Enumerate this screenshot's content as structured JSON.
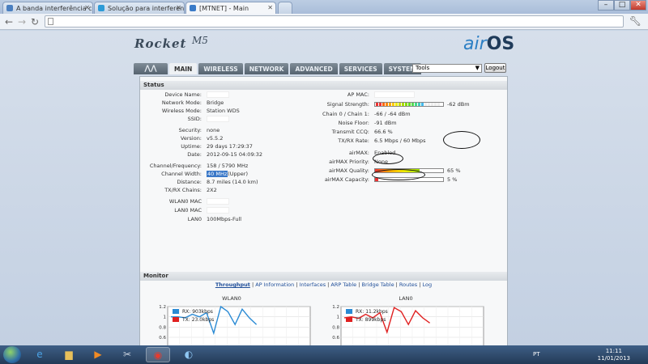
{
  "browser": {
    "tabs": [
      {
        "title": "A banda interferência com",
        "icon_color": "#4a7fc0"
      },
      {
        "title": "Solução para interferencia",
        "icon_color": "#2d9bd7"
      },
      {
        "title": "[MTNET] - Main",
        "icon_color": "#3a7bc8"
      }
    ],
    "window_buttons": [
      "–",
      "□",
      "✕"
    ],
    "back_icon": "back-arrow",
    "forward_icon": "forward-arrow",
    "reload_icon": "reload",
    "wrench_icon": "wrench"
  },
  "header": {
    "brand": "Rocket",
    "model": "M5",
    "airos_air": "air",
    "airos_os": "OS"
  },
  "nav": {
    "tabs": [
      "MAIN",
      "WIRELESS",
      "NETWORK",
      "ADVANCED",
      "SERVICES",
      "SYSTEM"
    ],
    "active": "MAIN",
    "tools_value": "Tools",
    "logout_label": "Logout"
  },
  "status": {
    "title": "Status",
    "left": [
      {
        "label": "Device Name:",
        "value": ""
      },
      {
        "label": "Network Mode:",
        "value": "Bridge"
      },
      {
        "label": "Wireless Mode:",
        "value": "Station WDS"
      },
      {
        "label": "SSID:",
        "value": ""
      },
      {
        "label": "Security:",
        "value": "none"
      },
      {
        "label": "Version:",
        "value": "v5.5.2"
      },
      {
        "label": "Uptime:",
        "value": "29 days 17:29:37"
      },
      {
        "label": "Date:",
        "value": "2012-09-15 04:09:32"
      },
      {
        "label": "Channel/Frequency:",
        "value": "158 / 5790 MHz"
      },
      {
        "label": "Channel Width:",
        "value": "40 MHz",
        "extra": "(Upper)"
      },
      {
        "label": "Distance:",
        "value": "8.7 miles (14.0 km)"
      },
      {
        "label": "TX/RX Chains:",
        "value": "2X2"
      },
      {
        "label": "WLAN0 MAC",
        "value": ""
      },
      {
        "label": "LAN0 MAC",
        "value": ""
      },
      {
        "label": "LAN0",
        "value": "100Mbps-Full"
      }
    ],
    "right": [
      {
        "label": "AP MAC:",
        "value": ""
      },
      {
        "label": "Signal Strength:",
        "value": "-62 dBm"
      },
      {
        "label": "Chain 0 / Chain 1:",
        "value": "-66 / -64 dBm"
      },
      {
        "label": "Noise Floor:",
        "value": "-91 dBm"
      },
      {
        "label": "Transmit CCQ:",
        "value": "66.6 %"
      },
      {
        "label": "TX/RX Rate:",
        "value": "6.5 Mbps / 60 Mbps"
      },
      {
        "label": "airMAX:",
        "value": "Enabled"
      },
      {
        "label": "airMAX Priority:",
        "value": "None"
      },
      {
        "label": "airMAX Quality:",
        "value": "65 %"
      },
      {
        "label": "airMAX Capacity:",
        "value": "5 %"
      }
    ],
    "signal_fraction": 0.75,
    "airmax_quality_fraction": 0.65,
    "airmax_capacity_fraction": 0.05
  },
  "monitor": {
    "title": "Monitor",
    "links": [
      "Throughput",
      "AP Information",
      "Interfaces",
      "ARP Table",
      "Bridge Table",
      "Routes",
      "Log"
    ],
    "active_link": "Throughput",
    "yticks": [
      "1.2",
      "1",
      "0.8",
      "0.6",
      "0.4",
      "0.2",
      "Mbps 0"
    ]
  },
  "chart_data": [
    {
      "type": "line",
      "title": "WLAN0",
      "ylim": [
        0,
        1.2
      ],
      "yticks": [
        0,
        0.2,
        0.4,
        0.6,
        0.8,
        1,
        1.2
      ],
      "series": [
        {
          "name": "RX: 903kbps",
          "color": "#2a8ad4",
          "values": [
            1.0,
            1.0,
            0.98,
            1.05,
            1.0,
            1.08,
            0.68,
            1.2,
            1.1,
            0.85,
            1.15,
            0.98,
            0.85
          ]
        },
        {
          "name": "TX: 23.0kbps",
          "color": "#e02020",
          "values": [
            0.02,
            0.03,
            0.02,
            0.02,
            0.03,
            0.02,
            0.02,
            0.03,
            0.02,
            0.02,
            0.02,
            0.03,
            0.02
          ]
        }
      ]
    },
    {
      "type": "line",
      "title": "LAN0",
      "ylim": [
        0,
        1.2
      ],
      "yticks": [
        0,
        0.2,
        0.4,
        0.6,
        0.8,
        1,
        1.2
      ],
      "series": [
        {
          "name": "RX: 11.2kbps",
          "color": "#2a8ad4",
          "values": [
            0.01,
            0.01,
            0.02,
            0.01,
            0.01,
            0.01,
            0.02,
            0.01,
            0.01,
            0.01,
            0.01,
            0.01,
            0.01
          ]
        },
        {
          "name": "TX: 899kbps",
          "color": "#e02020",
          "values": [
            0.98,
            1.0,
            0.97,
            1.05,
            0.98,
            1.08,
            0.7,
            1.18,
            1.1,
            0.85,
            1.12,
            0.98,
            0.88
          ]
        }
      ]
    }
  ],
  "taskbar": {
    "lang": "PT",
    "time": "11:11",
    "date": "11/01/2013",
    "apps": [
      "ie-icon",
      "explorer-icon",
      "media-player-icon",
      "tools-icon",
      "chrome-icon",
      "network-icon"
    ]
  }
}
